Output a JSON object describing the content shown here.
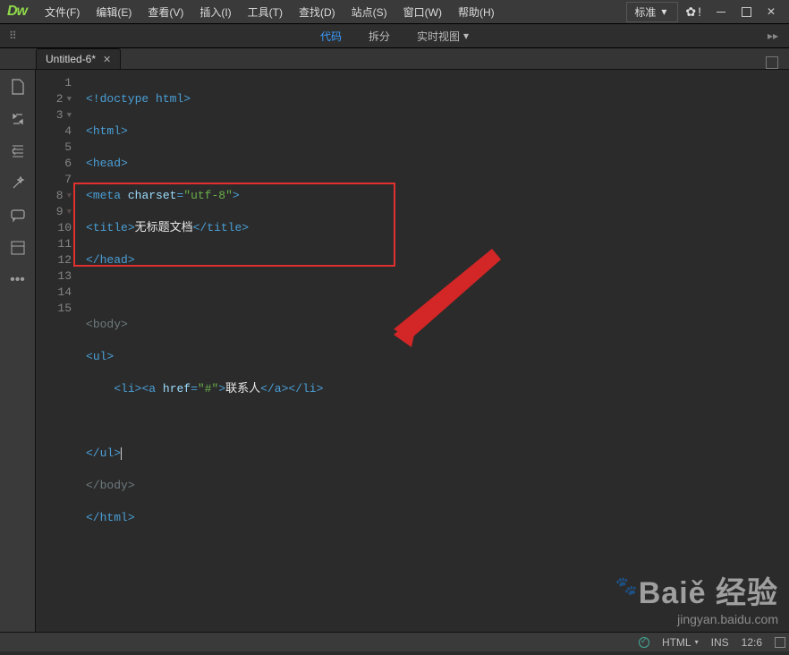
{
  "app_logo": "Dw",
  "menu": [
    {
      "label": "文件(F)"
    },
    {
      "label": "编辑(E)"
    },
    {
      "label": "查看(V)"
    },
    {
      "label": "插入(I)"
    },
    {
      "label": "工具(T)"
    },
    {
      "label": "查找(D)"
    },
    {
      "label": "站点(S)"
    },
    {
      "label": "窗口(W)"
    },
    {
      "label": "帮助(H)"
    }
  ],
  "workspace_label": "标准",
  "viewbar": {
    "code": "代码",
    "split": "拆分",
    "live": "实时视图"
  },
  "tab": {
    "title": "Untitled-6*"
  },
  "lines": [
    {
      "n": "1",
      "arrow": false
    },
    {
      "n": "2",
      "arrow": true
    },
    {
      "n": "3",
      "arrow": true
    },
    {
      "n": "4",
      "arrow": false
    },
    {
      "n": "5",
      "arrow": false
    },
    {
      "n": "6",
      "arrow": false
    },
    {
      "n": "7",
      "arrow": false
    },
    {
      "n": "8",
      "arrow": true,
      "mutedArrow": true
    },
    {
      "n": "9",
      "arrow": true,
      "mutedArrow": true
    },
    {
      "n": "10",
      "arrow": false
    },
    {
      "n": "11",
      "arrow": false
    },
    {
      "n": "12",
      "arrow": false
    },
    {
      "n": "13",
      "arrow": false
    },
    {
      "n": "14",
      "arrow": false
    },
    {
      "n": "15",
      "arrow": false
    }
  ],
  "code": {
    "l1": "<!doctype html>",
    "l2_open": "<",
    "l2_tag": "html",
    "l2_close": ">",
    "l3_open": "<",
    "l3_tag": "head",
    "l3_close": ">",
    "l4_open": "<",
    "l4_tag": "meta",
    "l4_sp": " ",
    "l4_attr": "charset",
    "l4_eq": "=",
    "l4_val": "\"utf-8\"",
    "l4_end": ">",
    "l5_open": "<",
    "l5_tag": "title",
    "l5_close": ">",
    "l5_text": "无标题文档",
    "l5_ctag": "</",
    "l5_ctagn": "title",
    "l5_cend": ">",
    "l6": "</",
    "l6_tag": "head",
    "l6_end": ">",
    "l8_open": "<",
    "l8_tag": "body",
    "l8_close": ">",
    "l9_open": "<",
    "l9_tag": "ul",
    "l9_close": ">",
    "l10_open": "<",
    "l10_tag": "li",
    "l10_close": ">",
    "l10_a_open": "<",
    "l10_a_tag": "a",
    "l10_sp": " ",
    "l10_attr": "href",
    "l10_eq": "=",
    "l10_val": "\"#\"",
    "l10_a_end": ">",
    "l10_text": "联系人",
    "l10_ac": "</",
    "l10_acn": "a",
    "l10_ace": ">",
    "l10_lic": "</",
    "l10_licn": "li",
    "l10_lice": ">",
    "l12_open": "</",
    "l12_tag": "ul",
    "l12_end": ">",
    "l13_open": "</",
    "l13_tag": "body",
    "l13_end": ">",
    "l14_open": "</",
    "l14_tag": "html",
    "l14_end": ">"
  },
  "status": {
    "lang": "HTML",
    "ins": "INS",
    "pos": "12:6"
  },
  "watermark": {
    "big": "Baiě 经验",
    "url": "jingyan.baidu.com"
  }
}
